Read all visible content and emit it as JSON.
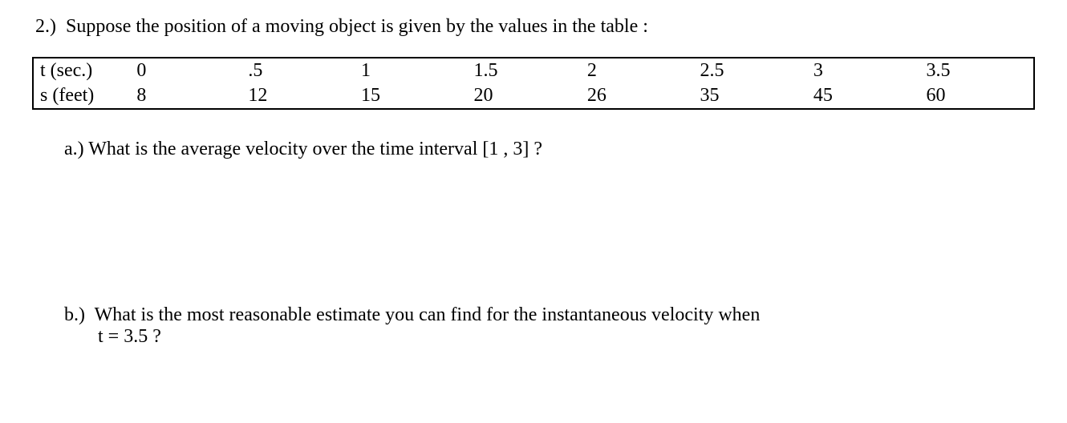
{
  "problem": {
    "number": "2.)",
    "intro": "Suppose the position of a moving object is given by the values in the table :"
  },
  "chart_data": {
    "type": "table",
    "title": "",
    "rows": [
      {
        "label": "t  (sec.)",
        "values": [
          "0",
          ".5",
          "1",
          "1.5",
          "2",
          "2.5",
          "3",
          "3.5"
        ]
      },
      {
        "label": "s  (feet)",
        "values": [
          "8",
          "12",
          "15",
          "20",
          "26",
          "35",
          "45",
          "60"
        ]
      }
    ]
  },
  "parts": {
    "a": {
      "label": "a.)",
      "text": "What is the average velocity over the time interval [1 , 3] ?"
    },
    "b": {
      "label": "b.)",
      "line1": "What is the most reasonable estimate you can find for the instantaneous velocity when",
      "line2": "t = 3.5 ?"
    }
  }
}
